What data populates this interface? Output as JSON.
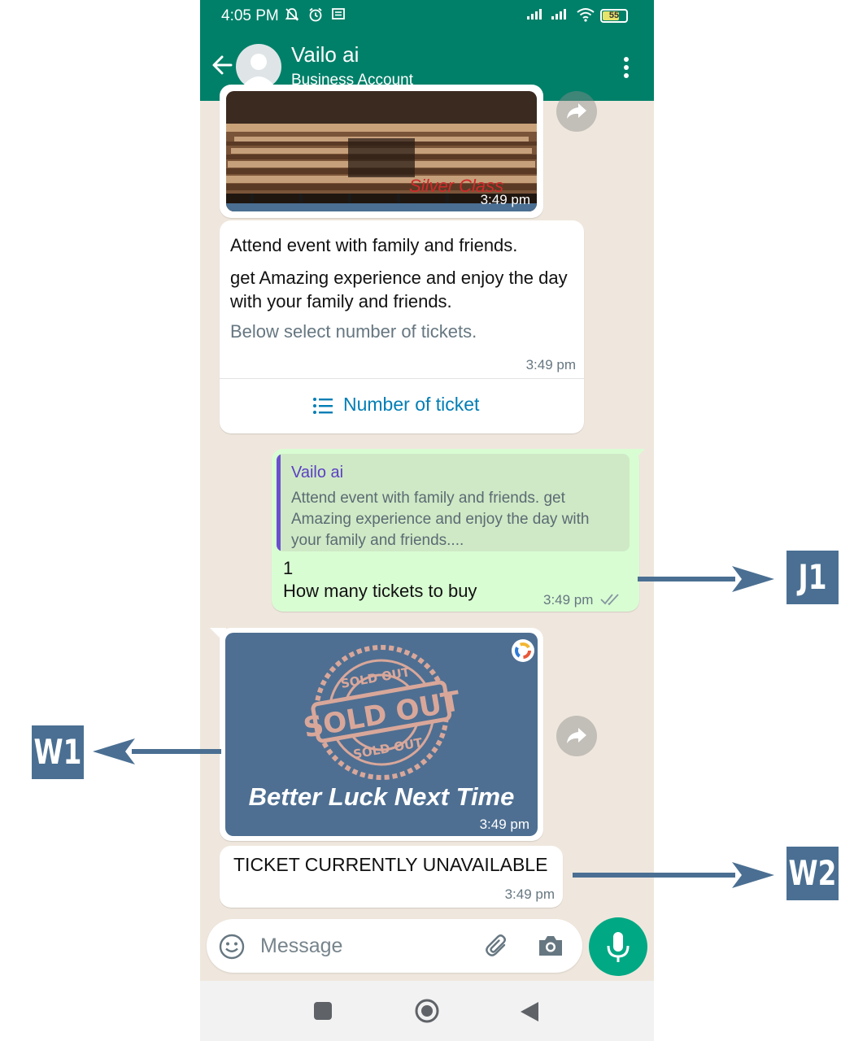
{
  "status_bar": {
    "time": "4:05 PM",
    "battery": "55"
  },
  "header": {
    "contact_name": "Vailo ai",
    "subtitle": "Business Account"
  },
  "messages": {
    "top_image": {
      "overlay_text": "Silver Class",
      "time": "3:49 pm"
    },
    "event": {
      "title": "Attend event with family and friends.",
      "body": "get Amazing experience and enjoy the day with your family and friends.",
      "footer": "Below select number of tickets.",
      "time": "3:49 pm",
      "button_label": "Number of ticket"
    },
    "reply": {
      "quoted_sender": "Vailo ai",
      "quoted_text": "Attend event with family and friends. get Amazing experience and enjoy the day with your family and friends....",
      "number": "1",
      "text": "How many tickets to buy",
      "time": "3:49 pm"
    },
    "sold_out": {
      "stamp_top": "SOLD OUT",
      "stamp_main": "SOLD OUT",
      "stamp_bottom": "SOLD OUT",
      "caption": "Better Luck Next Time",
      "time": "3:49 pm"
    },
    "unavailable": {
      "text": "TICKET CURRENTLY UNAVAILABLE",
      "time": "3:49 pm"
    }
  },
  "input": {
    "placeholder": "Message"
  },
  "annotations": {
    "j1": "J1",
    "w1": "W1",
    "w2": "W2"
  },
  "colors": {
    "header": "#008069",
    "outgoing_bubble": "#d9fdd3",
    "mic_button": "#00a884",
    "annotation": "#4a6f92",
    "link": "#027eb5"
  }
}
